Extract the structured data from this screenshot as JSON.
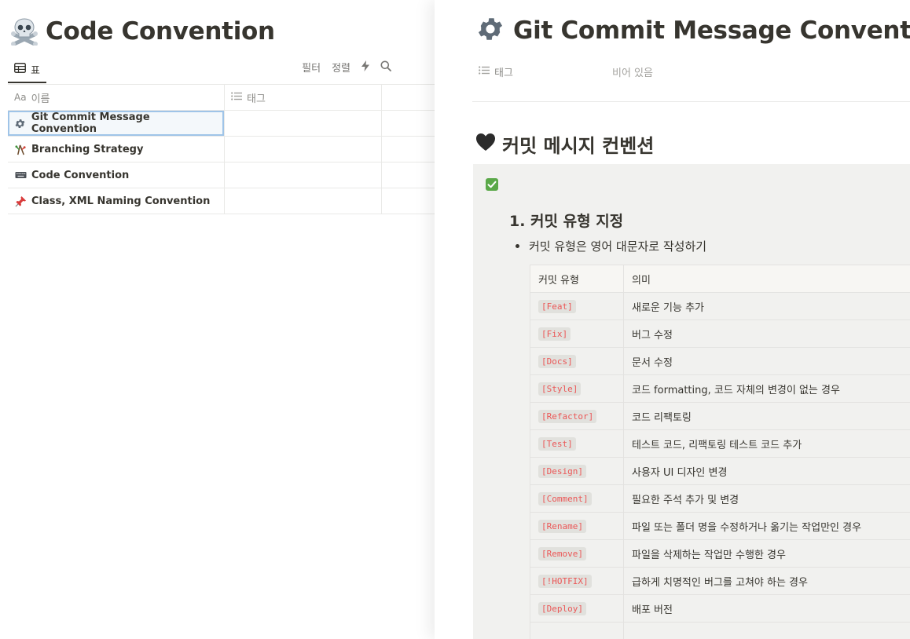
{
  "database": {
    "title": "Code Convention",
    "title_icon": "skull-and-crossbones-icon",
    "view_tab_label": "표",
    "actions": {
      "filter": "필터",
      "sort": "정렬"
    },
    "columns": {
      "name": "이름",
      "name_prefix": "Aa",
      "tag": "태그"
    },
    "rows": [
      {
        "icon": "gear-icon",
        "title": "Git Commit Message Convention"
      },
      {
        "icon": "branch-icon",
        "title": "Branching Strategy"
      },
      {
        "icon": "keyboard-icon",
        "title": "Code Convention"
      },
      {
        "icon": "pushpin-icon",
        "title": "Class, XML Naming Convention"
      }
    ]
  },
  "page": {
    "title": "Git Commit Message Convention",
    "title_icon": "gear-icon",
    "property": {
      "name": "태그",
      "value": "비어 있음"
    },
    "section_heading": "커밋 메시지 컨벤션",
    "subheading": "1. 커밋 유형 지정",
    "bullet": "커밋 유형은 영어 대문자로 작성하기",
    "table": {
      "header": {
        "type": "커밋 유형",
        "meaning": "의미"
      },
      "rows": [
        {
          "type": "[Feat]",
          "meaning": "새로운 기능 추가"
        },
        {
          "type": "[Fix]",
          "meaning": "버그 수정"
        },
        {
          "type": "[Docs]",
          "meaning": "문서 수정"
        },
        {
          "type": "[Style]",
          "meaning": "코드 formatting,  코드 자체의 변경이 없는 경우"
        },
        {
          "type": "[Refactor]",
          "meaning": "코드 리팩토링"
        },
        {
          "type": "[Test]",
          "meaning": "테스트 코드, 리팩토링 테스트 코드 추가"
        },
        {
          "type": "[Design]",
          "meaning": "사용자 UI 디자인 변경"
        },
        {
          "type": "[Comment]",
          "meaning": "필요한 주석 추가 및 변경"
        },
        {
          "type": "[Rename]",
          "meaning": "파일 또는 폴더 명을 수정하거나 옮기는 작업만인 경우"
        },
        {
          "type": "[Remove]",
          "meaning": "파일을 삭제하는 작업만 수행한 경우"
        },
        {
          "type": "[!HOTFIX]",
          "meaning": "급하게 치명적인 버그를 고쳐야 하는 경우"
        },
        {
          "type": "[Deploy]",
          "meaning": "배포 버전"
        },
        {
          "type": "",
          "meaning": ""
        }
      ]
    }
  },
  "colors": {
    "code_text": "#eb5757",
    "callout_bg": "#f1f1ef",
    "check_green": "#5aa848",
    "selection": "#9fc4e8"
  }
}
